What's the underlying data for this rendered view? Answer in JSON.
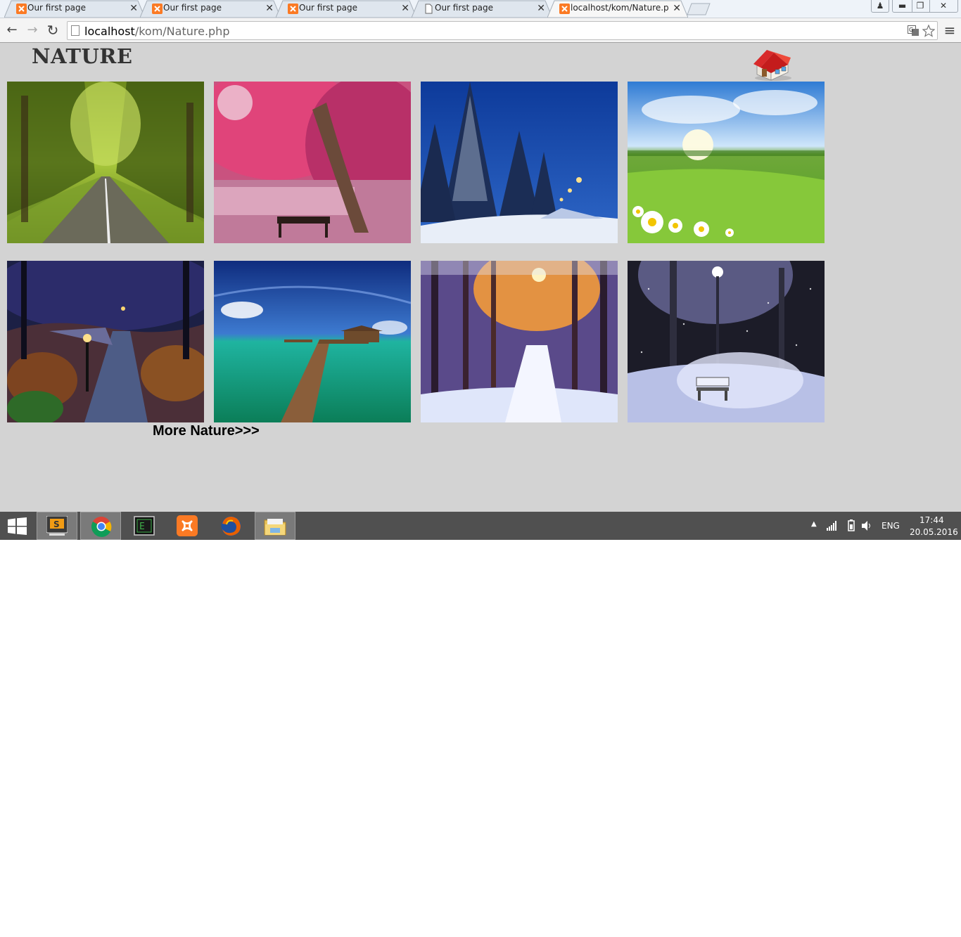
{
  "browser": {
    "tabs": [
      {
        "title": "Our first page",
        "favicon": "xampp-icon"
      },
      {
        "title": "Our first page",
        "favicon": "xampp-icon"
      },
      {
        "title": "Our first page",
        "favicon": "xampp-icon"
      },
      {
        "title": "Our first page",
        "favicon": "page-icon"
      },
      {
        "title": "localhost/kom/Nature.php",
        "favicon": "xampp-icon",
        "active": true
      }
    ],
    "tab_close": "✕",
    "address": {
      "host": "localhost",
      "path": "/kom/Nature.php"
    },
    "nav": {
      "back": "←",
      "forward": "→",
      "reload": "↻",
      "menu": "≡"
    }
  },
  "page": {
    "title": "NATURE",
    "home_icon": "house-icon",
    "photos": [
      {
        "subject": "tree-lined road"
      },
      {
        "subject": "pink tree by lake with bench"
      },
      {
        "subject": "snowy pine trees at night"
      },
      {
        "subject": "green meadow with daisies"
      },
      {
        "subject": "autumn park path at night"
      },
      {
        "subject": "wooden pier to tropical bungalow"
      },
      {
        "subject": "snowy forest at sunset"
      },
      {
        "subject": "snowy park bench under lamp"
      }
    ],
    "more_link": "More Nature>>>",
    "background": "#d3d3d3"
  },
  "taskbar": {
    "apps": [
      "windows-start-icon",
      "sublime-text-icon",
      "chrome-icon",
      "terminal-icon",
      "xampp-icon",
      "firefox-icon",
      "file-explorer-icon"
    ],
    "language": "ENG",
    "time": "17:44",
    "date": "20.05.2016"
  }
}
